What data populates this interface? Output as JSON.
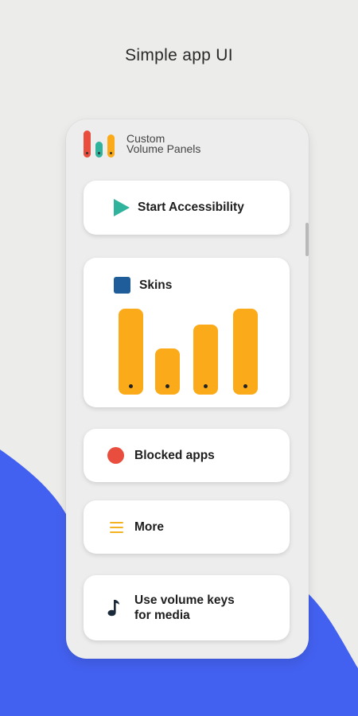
{
  "headline": "Simple app UI",
  "app": {
    "title_line1": "Custom",
    "title_line2": "Volume Panels",
    "logo_colors": [
      "#e84d3d",
      "#2fb39c",
      "#fbab1a"
    ]
  },
  "cards": {
    "start_accessibility": {
      "label": "Start Accessibility",
      "icon": "play-icon",
      "color": "#2fb39c"
    },
    "skins": {
      "label": "Skins",
      "icon": "square-icon",
      "color": "#1e5d99",
      "preview_bar_levels": [
        1.0,
        0.53,
        0.8,
        1.0
      ],
      "bar_color": "#fbab1a"
    },
    "blocked_apps": {
      "label": "Blocked apps",
      "icon": "circle-icon",
      "color": "#e84d3d"
    },
    "more": {
      "label": "More",
      "icon": "menu-icon",
      "color": "#f2b31f"
    },
    "volume_keys": {
      "label_line1": "Use volume keys",
      "label_line2": "for media",
      "icon": "music-note-icon",
      "color": "#1b2a3a"
    }
  },
  "colors": {
    "background": "#ececea",
    "wave": "#4361f0"
  }
}
